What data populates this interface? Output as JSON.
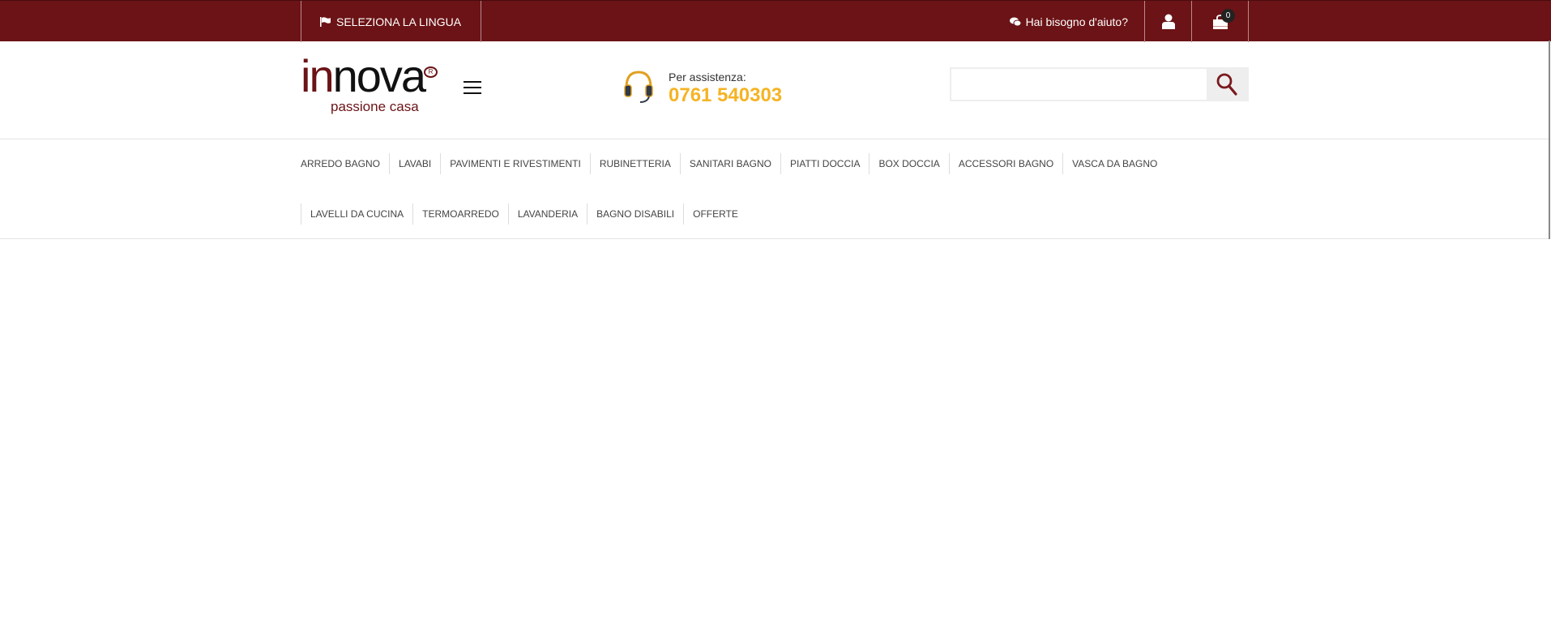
{
  "topbar": {
    "language_label": "SELEZIONA LA LINGUA",
    "help_label": "Hai bisogno d'aiuto?",
    "cart_count": "0"
  },
  "header": {
    "logo": {
      "brand": "innova",
      "tagline": "passione casa"
    },
    "support_label": "Per assistenza:",
    "support_phone": "0761 540303",
    "search": {
      "value": "",
      "placeholder": ""
    }
  },
  "colors": {
    "brand": "#6b1316",
    "accent": "#f5b324"
  },
  "nav": {
    "row1": [
      "ARREDO BAGNO",
      "LAVABI",
      "PAVIMENTI E RIVESTIMENTI",
      "RUBINETTERIA",
      "SANITARI BAGNO",
      "PIATTI DOCCIA",
      "BOX DOCCIA",
      "ACCESSORI BAGNO",
      "VASCA DA BAGNO"
    ],
    "row2": [
      "LAVELLI DA CUCINA",
      "TERMOARREDO",
      "LAVANDERIA",
      "BAGNO DISABILI",
      "OFFERTE"
    ]
  }
}
